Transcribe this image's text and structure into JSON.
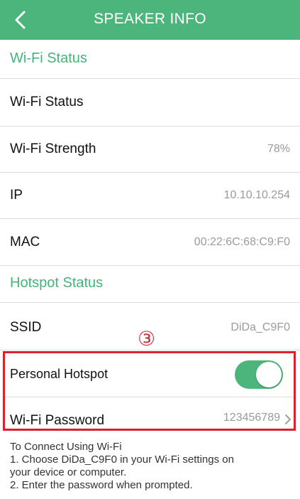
{
  "header": {
    "title": "SPEAKER INFO",
    "back_icon": "chevron-left-icon",
    "background_color": "#4cb57c"
  },
  "wifi_section": {
    "title": "Wi-Fi Status",
    "rows": {
      "status": {
        "label": "Wi-Fi Status",
        "value": ""
      },
      "strength": {
        "label": "Wi-Fi Strength",
        "value": "78%"
      },
      "ip": {
        "label": "IP",
        "value": "10.10.10.254"
      },
      "mac": {
        "label": "MAC",
        "value": "00:22:6C:68:C9:F0"
      }
    }
  },
  "hotspot_section": {
    "title": "Hotspot Status",
    "rows": {
      "ssid": {
        "label": "SSID",
        "value": "DiDa_C9F0"
      },
      "personal_hotspot": {
        "label": "Personal Hotspot",
        "toggle_on": true
      },
      "password": {
        "label": "Wi-Fi Password",
        "value": "123456789"
      }
    }
  },
  "annotation": {
    "marker": "③",
    "box_color": "#d9222e"
  },
  "instructions": {
    "lines": [
      "To Connect Using Wi-Fi",
      "1. Choose DiDa_C9F0 in your Wi-Fi settings on",
      "your device or computer.",
      "2. Enter the password when prompted."
    ]
  },
  "colors": {
    "accent": "#4cb57c",
    "section_title": "#47b27a",
    "value_text": "#9a9a9a"
  }
}
